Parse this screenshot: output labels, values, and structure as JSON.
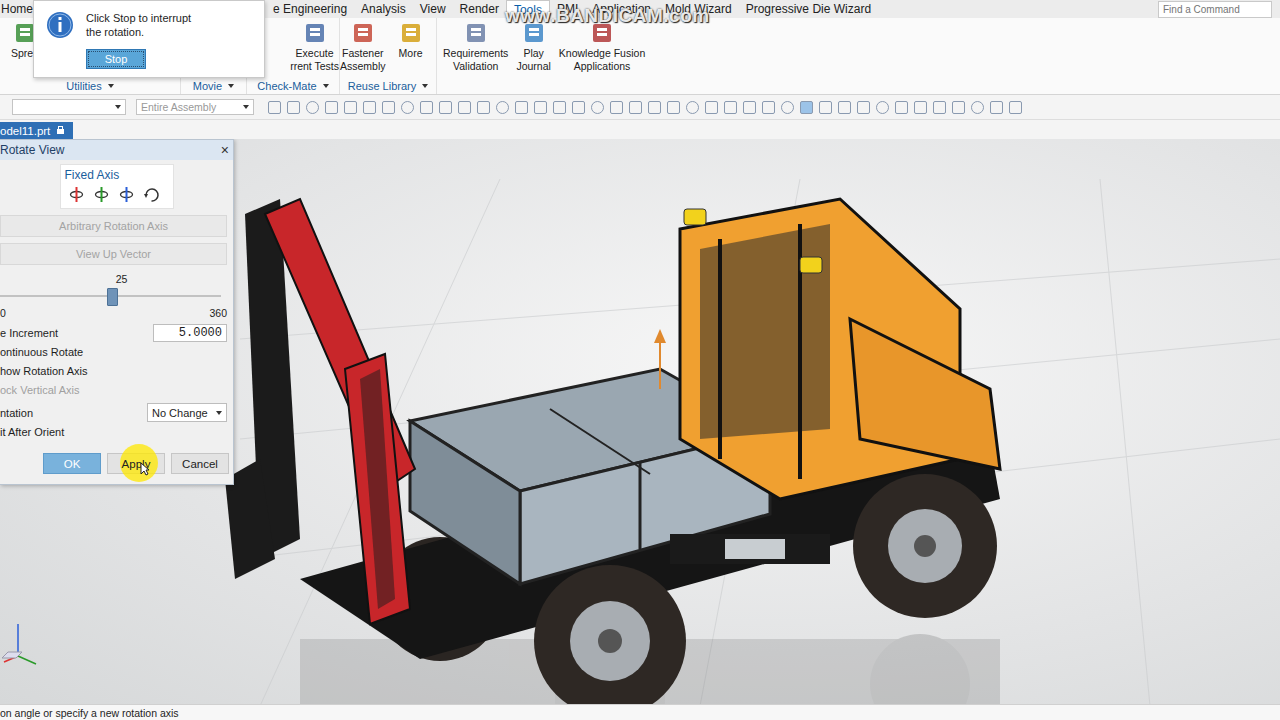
{
  "menu_tabs": [
    {
      "label": "Home",
      "selected": false
    },
    {
      "label": "e Engineering",
      "selected": false
    },
    {
      "label": "Analysis",
      "selected": false
    },
    {
      "label": "View",
      "selected": false
    },
    {
      "label": "Render",
      "selected": false
    },
    {
      "label": "Tools",
      "selected": true
    },
    {
      "label": "PMI",
      "selected": false
    },
    {
      "label": "Application",
      "selected": false
    },
    {
      "label": "Mold Wizard",
      "selected": false
    },
    {
      "label": "Progressive Die Wizard",
      "selected": false
    }
  ],
  "search": {
    "placeholder": "Find a Command"
  },
  "watermark": "www.BANDICAM.com",
  "tooltip": {
    "lines": [
      "Click Stop to interrupt",
      "the rotation."
    ],
    "button": "Stop"
  },
  "ribbon": {
    "groups": [
      {
        "label": "Utilities",
        "items": [
          {
            "lines": [
              "Sprea"
            ]
          }
        ]
      },
      {
        "label": "Movie",
        "items": []
      },
      {
        "label": "Check-Mate",
        "items": [
          {
            "lines": [
              "Execute",
              "rrent Tests"
            ]
          }
        ]
      },
      {
        "label": "Reuse Library",
        "items": [
          {
            "lines": [
              "Fastener",
              "Assembly"
            ]
          },
          {
            "lines": [
              "More"
            ]
          }
        ]
      },
      {
        "label": "",
        "items": [
          {
            "lines": [
              "Requirements",
              "Validation"
            ]
          },
          {
            "lines": [
              "Play",
              "Journal"
            ]
          },
          {
            "lines": [
              "Knowledge Fusion",
              "Applications"
            ]
          }
        ]
      }
    ]
  },
  "toolbar": {
    "filter": "",
    "scope": "Entire Assembly"
  },
  "file_tab": "odel11.prt",
  "dialog": {
    "title": "Rotate View",
    "close": "×",
    "group_title": "Fixed Axis",
    "disabled_buttons": [
      "Arbitrary Rotation Axis",
      "View Up Vector"
    ],
    "slider": {
      "value": "25",
      "min": "0",
      "max": "360",
      "level": 0.5
    },
    "increment": {
      "label": "e Increment",
      "value": "5.0000"
    },
    "options": [
      {
        "label": "ontinuous Rotate",
        "disabled": false
      },
      {
        "label": "how Rotation Axis",
        "disabled": false
      },
      {
        "label": "ock Vertical Axis",
        "disabled": true
      }
    ],
    "orientation": {
      "label": "ntation",
      "value": "No Change"
    },
    "fit": {
      "label": "it After Orient"
    },
    "actions": [
      {
        "label": "OK",
        "primary": true
      },
      {
        "label": "Apply",
        "primary": false
      },
      {
        "label": "Cancel",
        "primary": false
      }
    ]
  },
  "status_bar": "on angle or specify a new rotation axis"
}
